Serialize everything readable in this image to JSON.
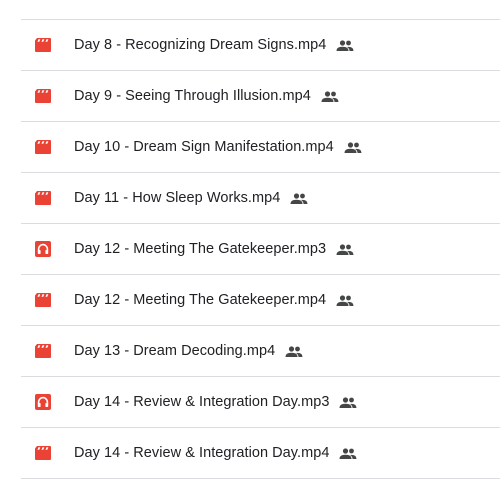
{
  "colors": {
    "video_icon": "#ea4335",
    "audio_icon": "#ea4335",
    "shared_icon": "#444746",
    "divider": "#dadce0",
    "text": "#202124"
  },
  "files": [
    {
      "name": "Day 8 - Recognizing Dream Signs.mp4",
      "icon": "video-icon",
      "shared": true
    },
    {
      "name": "Day 9 - Seeing Through Illusion.mp4",
      "icon": "video-icon",
      "shared": true
    },
    {
      "name": "Day 10 - Dream Sign Manifestation.mp4",
      "icon": "video-icon",
      "shared": true
    },
    {
      "name": "Day 11 - How Sleep Works.mp4",
      "icon": "video-icon",
      "shared": true
    },
    {
      "name": "Day 12 - Meeting The Gatekeeper.mp3",
      "icon": "audio-icon",
      "shared": true
    },
    {
      "name": "Day 12 - Meeting The Gatekeeper.mp4",
      "icon": "video-icon",
      "shared": true
    },
    {
      "name": "Day 13 - Dream Decoding.mp4",
      "icon": "video-icon",
      "shared": true
    },
    {
      "name": "Day 14 - Review & Integration Day.mp3",
      "icon": "audio-icon",
      "shared": true
    },
    {
      "name": "Day 14 - Review & Integration Day.mp4",
      "icon": "video-icon",
      "shared": true
    }
  ]
}
